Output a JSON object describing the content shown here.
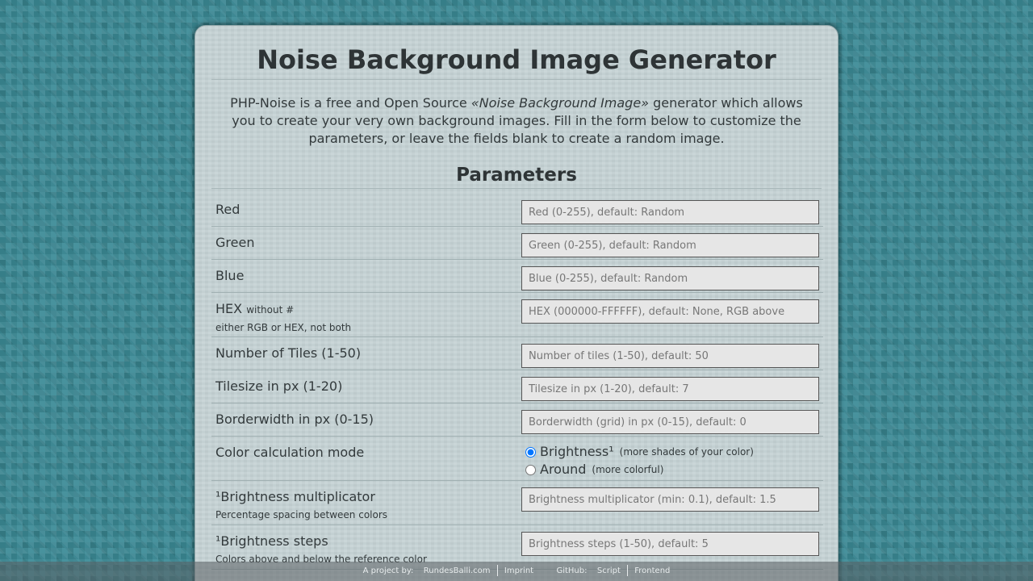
{
  "header": {
    "title": "Noise Background Image Generator"
  },
  "intro": {
    "part1": "PHP-Noise is a free and Open Source ",
    "emphasis": "«Noise Background Image»",
    "part2": " generator which allows you to create your very own background images. Fill in the form below to customize the parameters, or leave the fields blank to create a random image."
  },
  "parameters": {
    "heading": "Parameters",
    "red": {
      "label": "Red",
      "placeholder": "Red (0-255), default: Random"
    },
    "green": {
      "label": "Green",
      "placeholder": "Green (0-255), default: Random"
    },
    "blue": {
      "label": "Blue",
      "placeholder": "Blue (0-255), default: Random"
    },
    "hex": {
      "label": "HEX",
      "note": "without #",
      "sublabel": "either RGB or HEX, not both",
      "placeholder": "HEX (000000-FFFFFF), default: None, RGB above"
    },
    "tiles": {
      "label": "Number of Tiles (1-50)",
      "placeholder": "Number of tiles (1-50), default: 50"
    },
    "tilesize": {
      "label": "Tilesize in px (1-20)",
      "placeholder": "Tilesize in px (1-20), default: 7"
    },
    "borderwidth": {
      "label": "Borderwidth in px (0-15)",
      "placeholder": "Borderwidth (grid) in px (0-15), default: 0"
    },
    "mode": {
      "label": "Color calculation mode",
      "options": [
        {
          "label": "Brightness¹",
          "note": "(more shades of your color)",
          "selected": true
        },
        {
          "label": "Around",
          "note": "(more colorful)",
          "selected": false
        }
      ]
    },
    "multiplicator": {
      "label": "¹Brightness multiplicator",
      "sublabel": "Percentage spacing between colors",
      "placeholder": "Brightness multiplicator (min: 0.1), default: 1.5"
    },
    "steps": {
      "label": "¹Brightness steps",
      "sublabel": "Colors above and below the reference color",
      "placeholder": "Brightness steps (1-50), default: 5"
    }
  },
  "footer": {
    "project_label": "A project by:",
    "project_link": "RundesBalli.com",
    "imprint": "Imprint",
    "github_label": "GitHub:",
    "script": "Script",
    "frontend": "Frontend"
  },
  "colors": {
    "background": "#3b8a96",
    "panel": "#c5d2d4",
    "text": "#2e3436"
  }
}
